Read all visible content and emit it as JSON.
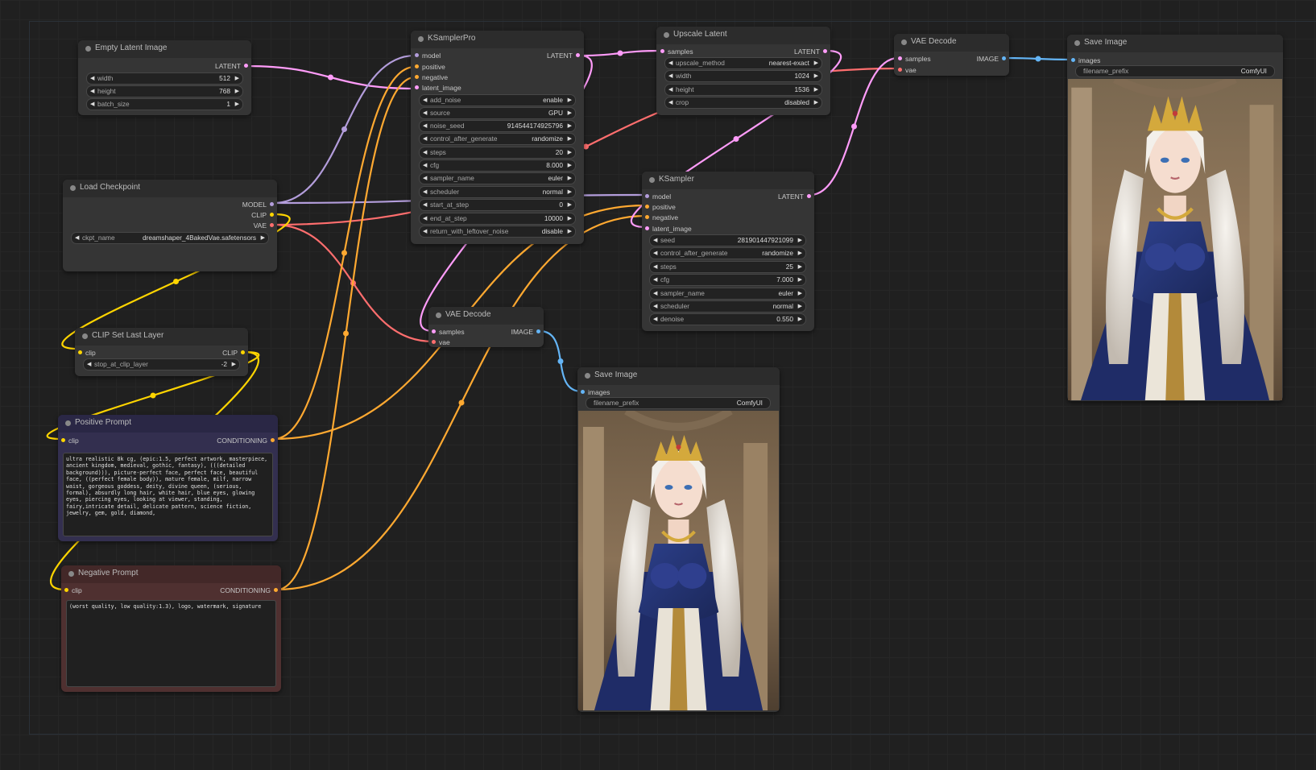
{
  "colors": {
    "background": "#202020",
    "node_body": "#353535",
    "node_header": "#2c2c2c",
    "latent": "#ff9cf9",
    "model": "#b39ddb",
    "clip": "#ffd500",
    "vae": "#ff6e6e",
    "conditioning": "#ffa931",
    "image": "#64b5f6",
    "positive_body": "#332f4f",
    "positive_header": "#2a2745",
    "negative_body": "#4f3030",
    "negative_header": "#432828"
  },
  "nodes": {
    "empty_latent": {
      "title": "Empty Latent Image",
      "outputs": [
        "LATENT"
      ],
      "widgets": [
        {
          "name": "width",
          "value": "512"
        },
        {
          "name": "height",
          "value": "768"
        },
        {
          "name": "batch_size",
          "value": "1"
        }
      ]
    },
    "load_checkpoint": {
      "title": "Load Checkpoint",
      "outputs": [
        "MODEL",
        "CLIP",
        "VAE"
      ],
      "widgets": [
        {
          "name": "ckpt_name",
          "value": "dreamshaper_4BakedVae.safetensors"
        }
      ]
    },
    "clip_set_last_layer": {
      "title": "CLIP Set Last Layer",
      "inputs": [
        "clip"
      ],
      "outputs": [
        "CLIP"
      ],
      "widgets": [
        {
          "name": "stop_at_clip_layer",
          "value": "-2"
        }
      ]
    },
    "positive_prompt": {
      "title": "Positive Prompt",
      "inputs": [
        "clip"
      ],
      "outputs": [
        "CONDITIONING"
      ],
      "text": "ultra realistic 8k cg, (epic:1.5, perfect artwork, masterpiece, ancient kingdom, medieval, gothic, fantasy), (((detailed background))), picture-perfect face, perfect face, beautiful face, ((perfect female body)), mature female, milf, narrow waist, gorgeous goddess, deity, divine queen, (serious, formal), absurdly long hair, white hair, blue eyes, glowing eyes, piercing eyes, looking at viewer, standing, fairy,intricate detail, delicate pattern, science fiction, jewelry, gem, gold, diamond,"
    },
    "negative_prompt": {
      "title": "Negative Prompt",
      "inputs": [
        "clip"
      ],
      "outputs": [
        "CONDITIONING"
      ],
      "text": "(worst quality, low quality:1.3), logo, watermark, signature"
    },
    "ksampler_pro": {
      "title": "KSamplerPro",
      "inputs": [
        "model",
        "positive",
        "negative",
        "latent_image"
      ],
      "outputs": [
        "LATENT"
      ],
      "widgets": [
        {
          "name": "add_noise",
          "value": "enable"
        },
        {
          "name": "source",
          "value": "GPU"
        },
        {
          "name": "noise_seed",
          "value": "914544174925796"
        },
        {
          "name": "control_after_generate",
          "value": "randomize"
        },
        {
          "name": "steps",
          "value": "20"
        },
        {
          "name": "cfg",
          "value": "8.000"
        },
        {
          "name": "sampler_name",
          "value": "euler"
        },
        {
          "name": "scheduler",
          "value": "normal"
        },
        {
          "name": "start_at_step",
          "value": "0"
        },
        {
          "name": "end_at_step",
          "value": "10000"
        },
        {
          "name": "return_with_leftover_noise",
          "value": "disable"
        }
      ]
    },
    "vae_decode_1": {
      "title": "VAE Decode",
      "inputs": [
        "samples",
        "vae"
      ],
      "outputs": [
        "IMAGE"
      ]
    },
    "upscale_latent": {
      "title": "Upscale Latent",
      "inputs": [
        "samples"
      ],
      "outputs": [
        "LATENT"
      ],
      "widgets": [
        {
          "name": "upscale_method",
          "value": "nearest-exact"
        },
        {
          "name": "width",
          "value": "1024"
        },
        {
          "name": "height",
          "value": "1536"
        },
        {
          "name": "crop",
          "value": "disabled"
        }
      ]
    },
    "ksampler": {
      "title": "KSampler",
      "inputs": [
        "model",
        "positive",
        "negative",
        "latent_image"
      ],
      "outputs": [
        "LATENT"
      ],
      "widgets": [
        {
          "name": "seed",
          "value": "281901447921099"
        },
        {
          "name": "control_after_generate",
          "value": "randomize"
        },
        {
          "name": "steps",
          "value": "25"
        },
        {
          "name": "cfg",
          "value": "7.000"
        },
        {
          "name": "sampler_name",
          "value": "euler"
        },
        {
          "name": "scheduler",
          "value": "normal"
        },
        {
          "name": "denoise",
          "value": "0.550"
        }
      ]
    },
    "vae_decode_2": {
      "title": "VAE Decode",
      "inputs": [
        "samples",
        "vae"
      ],
      "outputs": [
        "IMAGE"
      ]
    },
    "save_image_1": {
      "title": "Save Image",
      "inputs": [
        "images"
      ],
      "widgets": [
        {
          "name": "filename_prefix",
          "value": "ComfyUI"
        }
      ]
    },
    "save_image_2": {
      "title": "Save Image",
      "inputs": [
        "images"
      ],
      "widgets": [
        {
          "name": "filename_prefix",
          "value": "ComfyUI"
        }
      ]
    }
  }
}
